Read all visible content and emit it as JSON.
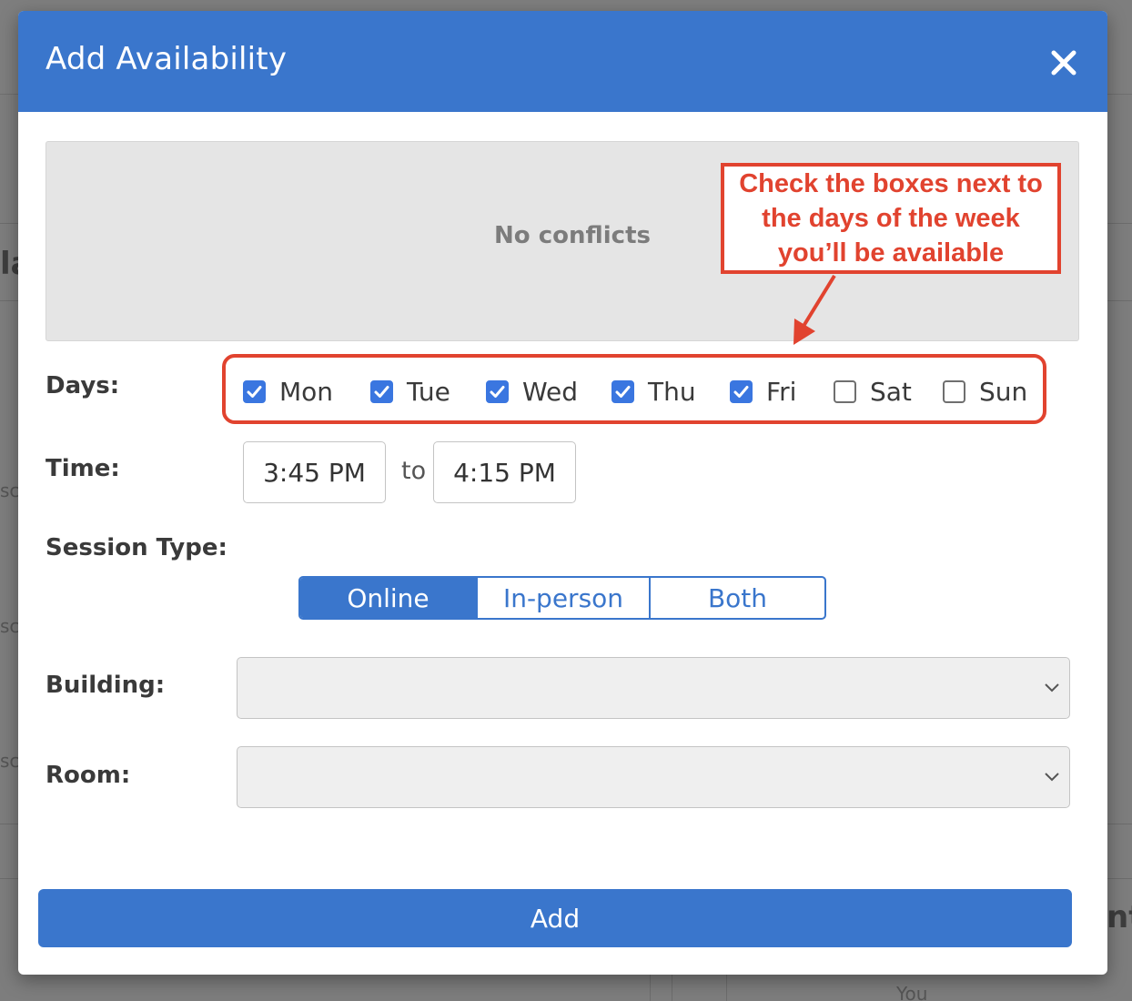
{
  "background": {
    "fragments": [
      "la",
      "sc",
      "sc",
      "sc",
      "nt",
      "You"
    ]
  },
  "modal": {
    "title": "Add Availability",
    "close_icon": "close-icon",
    "conflicts_text": "No conflicts",
    "callout_text": "Check the boxes next to the days of the week you’ll be available",
    "labels": {
      "days": "Days:",
      "time": "Time:",
      "session_type": "Session Type:",
      "building": "Building:",
      "room": "Room:"
    },
    "days": [
      {
        "label": "Mon",
        "checked": true
      },
      {
        "label": "Tue",
        "checked": true
      },
      {
        "label": "Wed",
        "checked": true
      },
      {
        "label": "Thu",
        "checked": true
      },
      {
        "label": "Fri",
        "checked": true
      },
      {
        "label": "Sat",
        "checked": false
      },
      {
        "label": "Sun",
        "checked": false
      }
    ],
    "time": {
      "start": "3:45 PM",
      "separator": "to",
      "end": "4:15 PM"
    },
    "session_types": [
      {
        "label": "Online",
        "selected": true
      },
      {
        "label": "In-person",
        "selected": false
      },
      {
        "label": "Both",
        "selected": false
      }
    ],
    "building_value": "",
    "room_value": "",
    "add_button": "Add"
  },
  "colors": {
    "primary": "#3a76cc",
    "checkbox": "#3a76e0",
    "annotation": "#e1432f",
    "conflict_bg": "#e5e5e5"
  }
}
